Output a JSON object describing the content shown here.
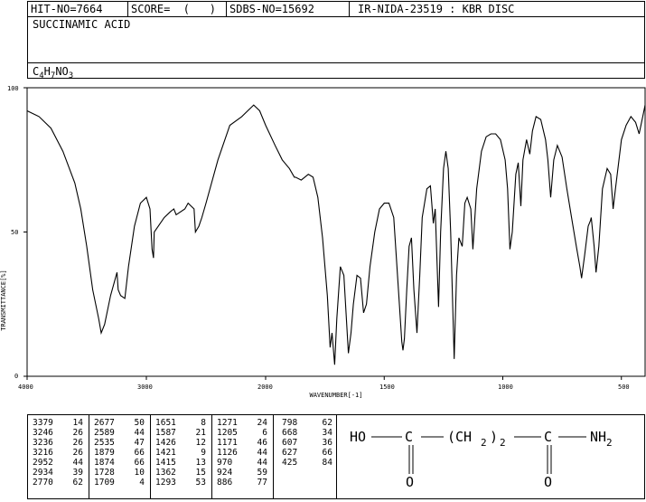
{
  "header": {
    "hit_no": "HIT-NO=7664",
    "score": "SCORE=  (   )",
    "sdbs_no": "SDBS-NO=15692",
    "ir_info": "IR-NIDA-23519 : KBR DISC"
  },
  "compound": {
    "name": "SUCCINAMIC ACID",
    "formula_parts": [
      {
        "t": "C",
        "sub": false
      },
      {
        "t": "4",
        "sub": true
      },
      {
        "t": "H",
        "sub": false
      },
      {
        "t": "7",
        "sub": true
      },
      {
        "t": "NO",
        "sub": false
      },
      {
        "t": "3",
        "sub": true
      }
    ]
  },
  "chart_data": {
    "type": "line",
    "xlabel": "WAVENUMBER[-1]",
    "ylabel": "TRANSMITTANCE[%]",
    "xlim": [
      4000,
      400
    ],
    "ylim": [
      0,
      100
    ],
    "x_ticks": [
      "4000",
      "3000",
      "2000",
      "1500",
      "1000",
      "500"
    ],
    "y_ticks": [
      "100",
      "50",
      "0"
    ],
    "spectrum": [
      [
        4000,
        92
      ],
      [
        3900,
        90
      ],
      [
        3800,
        86
      ],
      [
        3700,
        78
      ],
      [
        3600,
        67
      ],
      [
        3550,
        58
      ],
      [
        3500,
        45
      ],
      [
        3450,
        30
      ],
      [
        3400,
        20
      ],
      [
        3379,
        15
      ],
      [
        3350,
        18
      ],
      [
        3300,
        28
      ],
      [
        3246,
        36
      ],
      [
        3236,
        30
      ],
      [
        3216,
        28
      ],
      [
        3180,
        27
      ],
      [
        3150,
        38
      ],
      [
        3100,
        52
      ],
      [
        3050,
        60
      ],
      [
        3000,
        62
      ],
      [
        2970,
        58
      ],
      [
        2952,
        44
      ],
      [
        2940,
        41
      ],
      [
        2934,
        50
      ],
      [
        2900,
        52
      ],
      [
        2850,
        55
      ],
      [
        2800,
        57
      ],
      [
        2770,
        58
      ],
      [
        2750,
        56
      ],
      [
        2677,
        58
      ],
      [
        2650,
        60
      ],
      [
        2600,
        58
      ],
      [
        2589,
        50
      ],
      [
        2560,
        52
      ],
      [
        2535,
        55
      ],
      [
        2500,
        60
      ],
      [
        2400,
        75
      ],
      [
        2300,
        87
      ],
      [
        2200,
        90
      ],
      [
        2100,
        94
      ],
      [
        2050,
        92
      ],
      [
        2000,
        87
      ],
      [
        1960,
        80
      ],
      [
        1930,
        75
      ],
      [
        1900,
        72
      ],
      [
        1879,
        69
      ],
      [
        1874,
        69
      ],
      [
        1850,
        68
      ],
      [
        1820,
        70
      ],
      [
        1800,
        69
      ],
      [
        1780,
        62
      ],
      [
        1760,
        48
      ],
      [
        1740,
        28
      ],
      [
        1728,
        10
      ],
      [
        1720,
        15
      ],
      [
        1709,
        4
      ],
      [
        1700,
        20
      ],
      [
        1685,
        38
      ],
      [
        1670,
        35
      ],
      [
        1651,
        8
      ],
      [
        1640,
        15
      ],
      [
        1630,
        25
      ],
      [
        1615,
        35
      ],
      [
        1600,
        34
      ],
      [
        1587,
        22
      ],
      [
        1575,
        25
      ],
      [
        1560,
        38
      ],
      [
        1540,
        50
      ],
      [
        1520,
        58
      ],
      [
        1500,
        60
      ],
      [
        1480,
        60
      ],
      [
        1460,
        55
      ],
      [
        1440,
        30
      ],
      [
        1426,
        12
      ],
      [
        1421,
        9
      ],
      [
        1415,
        13
      ],
      [
        1405,
        30
      ],
      [
        1395,
        45
      ],
      [
        1385,
        48
      ],
      [
        1375,
        30
      ],
      [
        1362,
        15
      ],
      [
        1350,
        35
      ],
      [
        1340,
        55
      ],
      [
        1320,
        65
      ],
      [
        1305,
        66
      ],
      [
        1293,
        53
      ],
      [
        1285,
        58
      ],
      [
        1271,
        24
      ],
      [
        1262,
        50
      ],
      [
        1250,
        72
      ],
      [
        1240,
        78
      ],
      [
        1230,
        72
      ],
      [
        1220,
        50
      ],
      [
        1205,
        6
      ],
      [
        1195,
        35
      ],
      [
        1185,
        48
      ],
      [
        1171,
        45
      ],
      [
        1160,
        60
      ],
      [
        1150,
        62
      ],
      [
        1135,
        58
      ],
      [
        1126,
        44
      ],
      [
        1110,
        65
      ],
      [
        1090,
        78
      ],
      [
        1070,
        83
      ],
      [
        1050,
        84
      ],
      [
        1030,
        84
      ],
      [
        1010,
        82
      ],
      [
        990,
        75
      ],
      [
        980,
        65
      ],
      [
        970,
        44
      ],
      [
        960,
        50
      ],
      [
        945,
        70
      ],
      [
        935,
        74
      ],
      [
        924,
        59
      ],
      [
        915,
        75
      ],
      [
        900,
        82
      ],
      [
        886,
        77
      ],
      [
        875,
        85
      ],
      [
        860,
        90
      ],
      [
        840,
        89
      ],
      [
        820,
        82
      ],
      [
        810,
        75
      ],
      [
        798,
        62
      ],
      [
        785,
        75
      ],
      [
        770,
        80
      ],
      [
        750,
        76
      ],
      [
        730,
        65
      ],
      [
        710,
        55
      ],
      [
        690,
        45
      ],
      [
        675,
        38
      ],
      [
        668,
        34
      ],
      [
        655,
        42
      ],
      [
        640,
        52
      ],
      [
        630,
        54
      ],
      [
        627,
        55
      ],
      [
        615,
        45
      ],
      [
        607,
        36
      ],
      [
        595,
        45
      ],
      [
        580,
        65
      ],
      [
        560,
        72
      ],
      [
        545,
        70
      ],
      [
        535,
        58
      ],
      [
        525,
        65
      ],
      [
        500,
        82
      ],
      [
        480,
        87
      ],
      [
        460,
        90
      ],
      [
        440,
        88
      ],
      [
        425,
        84
      ],
      [
        410,
        90
      ],
      [
        400,
        94
      ]
    ]
  },
  "peaks": {
    "columns": [
      [
        [
          "3379",
          "14"
        ],
        [
          "3246",
          "26"
        ],
        [
          "3236",
          "26"
        ],
        [
          "3216",
          "26"
        ],
        [
          "2952",
          "44"
        ],
        [
          "2934",
          "39"
        ],
        [
          "2770",
          "62"
        ]
      ],
      [
        [
          "2677",
          "50"
        ],
        [
          "2589",
          "44"
        ],
        [
          "2535",
          "47"
        ],
        [
          "1879",
          "66"
        ],
        [
          "1874",
          "66"
        ],
        [
          "1728",
          "10"
        ],
        [
          "1709",
          "4"
        ]
      ],
      [
        [
          "1651",
          "8"
        ],
        [
          "1587",
          "21"
        ],
        [
          "1426",
          "12"
        ],
        [
          "1421",
          "9"
        ],
        [
          "1415",
          "13"
        ],
        [
          "1362",
          "15"
        ],
        [
          "1293",
          "53"
        ]
      ],
      [
        [
          "1271",
          "24"
        ],
        [
          "1205",
          "6"
        ],
        [
          "1171",
          "46"
        ],
        [
          "1126",
          "44"
        ],
        [
          "970",
          "44"
        ],
        [
          "924",
          "59"
        ],
        [
          "886",
          "77"
        ]
      ],
      [
        [
          "798",
          "62"
        ],
        [
          "668",
          "34"
        ],
        [
          "607",
          "36"
        ],
        [
          "627",
          "66"
        ],
        [
          "425",
          "84"
        ]
      ]
    ]
  },
  "structure": {
    "ho": "HO",
    "c1": "C",
    "ch2_open": "(CH",
    "ch2_sub": "2",
    "ch2_close": ")",
    "repeat_sub": "2",
    "c2": "C",
    "nh": "NH",
    "nh_sub": "2",
    "o1": "O",
    "o2": "O"
  }
}
